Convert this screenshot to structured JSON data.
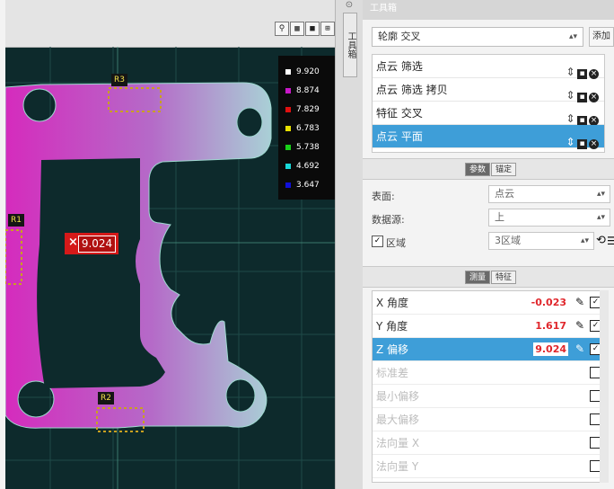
{
  "viewport": {
    "toolbar_icons": [
      "axes-icon",
      "grid-icon",
      "view-cube-icon",
      "fit-view-icon"
    ],
    "toolbar_glyphs": [
      "⚲",
      "▦",
      "■",
      "⊞"
    ],
    "legend": [
      {
        "value": "9.920",
        "color": "#ffffff"
      },
      {
        "value": "8.874",
        "color": "#c818c8"
      },
      {
        "value": "7.829",
        "color": "#e01010"
      },
      {
        "value": "6.783",
        "color": "#e8e000"
      },
      {
        "value": "5.738",
        "color": "#18d018"
      },
      {
        "value": "4.692",
        "color": "#18d8d8"
      },
      {
        "value": "3.647",
        "color": "#1010d8"
      }
    ],
    "region_labels": {
      "r1": "R1",
      "r2": "R2",
      "r3": "R3"
    },
    "measure_icon": "×",
    "measure_value": "9.024"
  },
  "splitter": {
    "tab_label": "工具箱"
  },
  "panel": {
    "title": "工具箱",
    "feature_select": "轮廓 交叉",
    "add_button": "添加",
    "operations": [
      {
        "label": "点云 筛选",
        "selected": false
      },
      {
        "label": "点云 筛选 拷贝",
        "selected": false
      },
      {
        "label": "特征 交叉",
        "selected": false
      },
      {
        "label": "点云 平面",
        "selected": true
      }
    ],
    "tabs1": {
      "params": "参数",
      "anchor": "锚定"
    },
    "fields": {
      "surface_label": "表面:",
      "surface_value": "点云",
      "source_label": "数据源:",
      "source_value": "上",
      "region_label": "区域",
      "region_value": "3区域"
    },
    "tabs2": {
      "measure": "测量",
      "feature": "特征"
    },
    "measurements": [
      {
        "label": "X 角度",
        "value": "-0.023",
        "checked": true,
        "enabled": true,
        "selected": false
      },
      {
        "label": "Y 角度",
        "value": "1.617",
        "checked": true,
        "enabled": true,
        "selected": false
      },
      {
        "label": "Z 偏移",
        "value": "9.024",
        "checked": true,
        "enabled": true,
        "selected": true
      },
      {
        "label": "标准差",
        "value": "",
        "checked": false,
        "enabled": false,
        "selected": false
      },
      {
        "label": "最小偏移",
        "value": "",
        "checked": false,
        "enabled": false,
        "selected": false
      },
      {
        "label": "最大偏移",
        "value": "",
        "checked": false,
        "enabled": false,
        "selected": false
      },
      {
        "label": "法向量 X",
        "value": "",
        "checked": false,
        "enabled": false,
        "selected": false
      },
      {
        "label": "法向量 Y",
        "value": "",
        "checked": false,
        "enabled": false,
        "selected": false
      }
    ]
  }
}
